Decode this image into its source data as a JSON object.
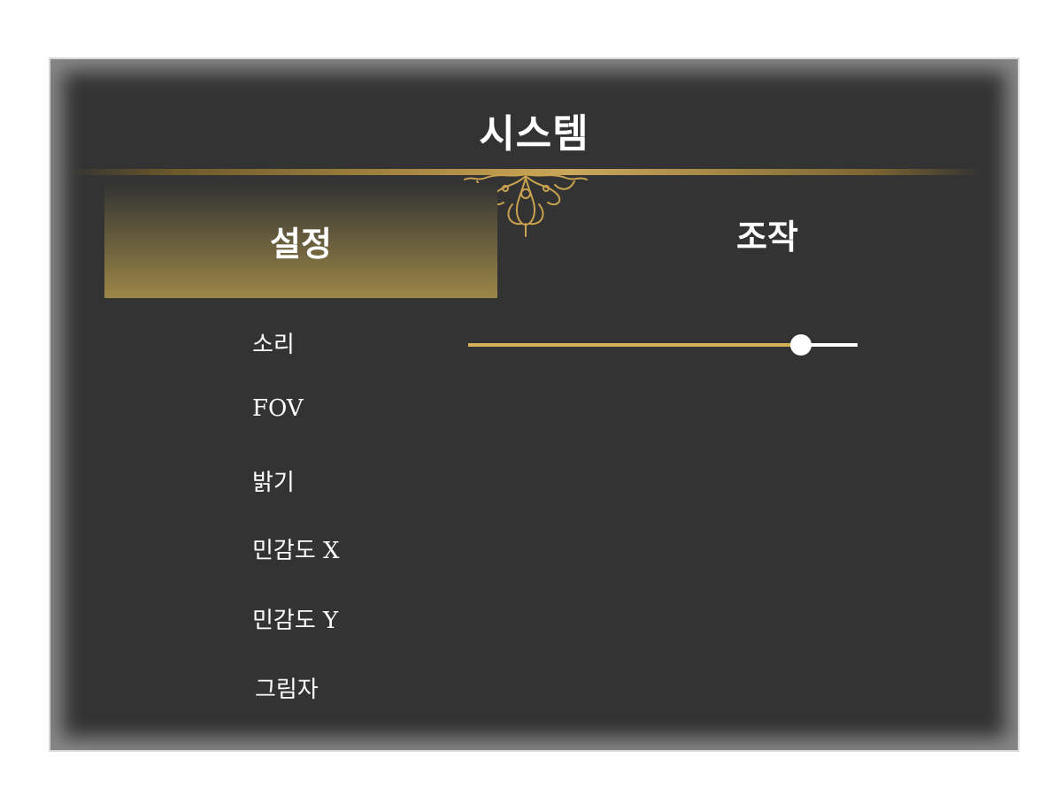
{
  "window": {
    "title": "시스템"
  },
  "tabs": [
    {
      "label": "설정",
      "active": true
    },
    {
      "label": "조작",
      "active": false
    }
  ],
  "settings": [
    {
      "label": "소리"
    },
    {
      "label": "FOV"
    },
    {
      "label": "밝기"
    },
    {
      "label": "민감도 X"
    },
    {
      "label": "민감도 Y"
    },
    {
      "label": "그림자"
    }
  ],
  "sound_slider": {
    "value_fraction": 0.855
  },
  "colors": {
    "panel_background": "#333333",
    "accent_gold": "#d6b15c",
    "text": "#ffffff"
  }
}
